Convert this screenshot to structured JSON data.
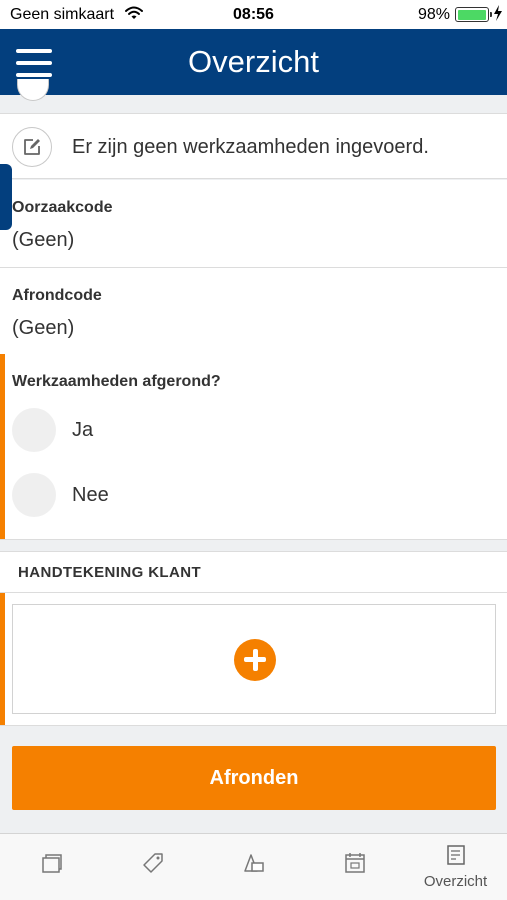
{
  "status_bar": {
    "carrier": "Geen simkaart",
    "time": "08:56",
    "battery_percent": "98%",
    "battery_level": 0.98
  },
  "nav": {
    "title": "Overzicht",
    "menu_icon": "hamburger-menu-icon"
  },
  "work": {
    "text": "Er zijn geen werkzaamheden ingevoerd.",
    "icon": "edit-icon"
  },
  "fields": [
    {
      "label": "Oorzaakcode",
      "value": "(Geen)"
    },
    {
      "label": "Afrondcode",
      "value": "(Geen)"
    }
  ],
  "question": {
    "label": "Werkzaamheden afgerond?",
    "options": [
      "Ja",
      "Nee"
    ],
    "selected": null
  },
  "signature": {
    "title": "HANDTEKENING KLANT",
    "add_icon": "plus-icon"
  },
  "actions": {
    "afronden_label": "Afronden"
  },
  "tabs": [
    {
      "icon": "folder-icon",
      "label": ""
    },
    {
      "icon": "tag-icon",
      "label": ""
    },
    {
      "icon": "shapes-icon",
      "label": ""
    },
    {
      "icon": "calendar-icon",
      "label": ""
    },
    {
      "icon": "document-icon",
      "label": "Overzicht"
    }
  ],
  "colors": {
    "nav_bar": "#033f7e",
    "accent": "#f58000",
    "battery": "#4cd964"
  }
}
